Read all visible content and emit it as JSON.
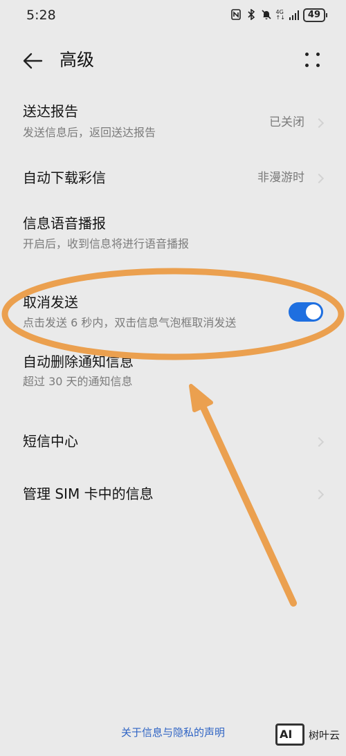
{
  "status_bar": {
    "time": "5:28",
    "network": "4G",
    "battery": "49"
  },
  "header": {
    "title": "高级"
  },
  "settings": [
    {
      "title": "送达报告",
      "subtitle": "发送信息后，返回送达报告",
      "value": "已关闭"
    },
    {
      "title": "自动下载彩信",
      "value": "非漫游时"
    },
    {
      "title": "信息语音播报",
      "subtitle": "开启后，收到信息将进行语音播报"
    },
    {
      "title": "取消发送",
      "subtitle": "点击发送 6 秒内，双击信息气泡框取消发送",
      "toggle_on": true
    },
    {
      "title": "自动删除通知信息",
      "subtitle": "超过 30 天的通知信息"
    },
    {
      "title": "短信中心"
    },
    {
      "title": "管理 SIM 卡中的信息"
    }
  ],
  "footer": {
    "privacy_link": "关于信息与隐私的声明"
  },
  "watermark": {
    "logo": "AI",
    "text": "树叶云"
  },
  "colors": {
    "accent": "#1e6fe0",
    "annotation": "#eba04f",
    "background": "#eaeaea",
    "link": "#2f64c4"
  }
}
